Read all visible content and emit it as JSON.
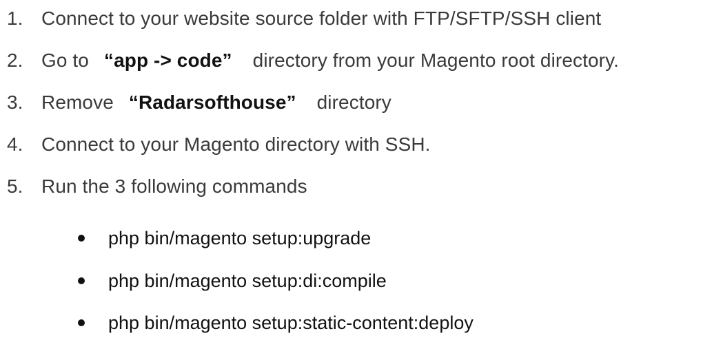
{
  "steps": [
    {
      "num": "1.",
      "text": "Connect to your website source folder with FTP/SFTP/SSH client"
    },
    {
      "num": "2.",
      "pre": "Go to",
      "strong": "“app -> code”",
      "post": "directory from your Magento root directory."
    },
    {
      "num": "3.",
      "pre": "Remove",
      "strong": "“Radarsofthouse”",
      "post": "directory"
    },
    {
      "num": "4.",
      "text": "Connect to your Magento directory with SSH."
    },
    {
      "num": "5.",
      "text": "Run the 3 following commands"
    }
  ],
  "commands": [
    "php bin/magento setup:upgrade",
    "php bin/magento setup:di:compile",
    "php bin/magento setup:static-content:deploy"
  ]
}
